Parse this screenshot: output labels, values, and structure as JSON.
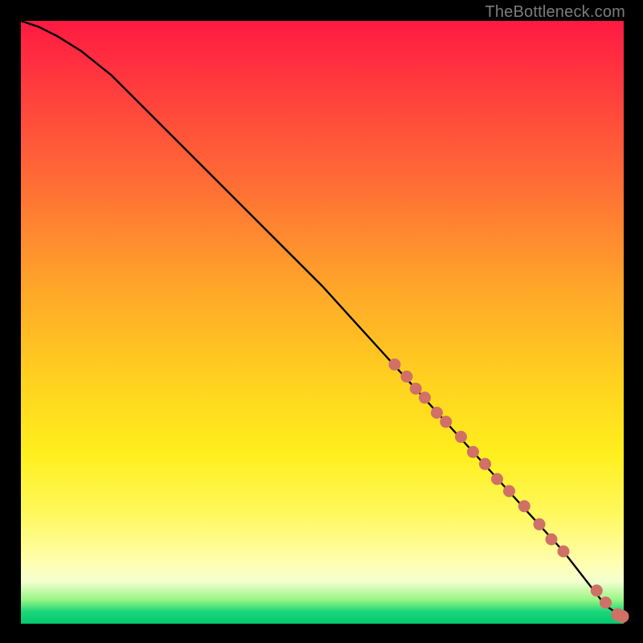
{
  "watermark": "TheBottleneck.com",
  "chart_data": {
    "type": "line",
    "title": "",
    "xlabel": "",
    "ylabel": "",
    "xlim": [
      0,
      100
    ],
    "ylim": [
      0,
      100
    ],
    "grid": false,
    "legend": null,
    "series": [
      {
        "name": "curve",
        "x": [
          0,
          3,
          6,
          10,
          15,
          20,
          30,
          40,
          50,
          60,
          70,
          80,
          90,
          97,
          100
        ],
        "y": [
          100,
          99,
          97.5,
          95,
          91,
          86,
          76,
          66,
          56,
          45,
          34,
          23,
          12,
          3,
          1
        ]
      }
    ],
    "scatter_on_curve": {
      "name": "dots",
      "x": [
        62,
        64,
        65.5,
        67,
        69,
        70.5,
        73,
        75,
        77,
        79,
        81,
        83.5,
        86,
        88,
        90,
        95.5,
        97,
        99,
        99.8
      ],
      "y": [
        43,
        41,
        39,
        37.5,
        35,
        33.5,
        31,
        28.5,
        26.5,
        24,
        22,
        19.5,
        16.5,
        14,
        12,
        5.5,
        3.5,
        1.5,
        1.2
      ]
    },
    "colors": {
      "curve": "#000000",
      "dots": "#d07066",
      "gradient_top": "#ff1a42",
      "gradient_mid": "#ffd21f",
      "gradient_bottom": "#05c86f"
    }
  }
}
